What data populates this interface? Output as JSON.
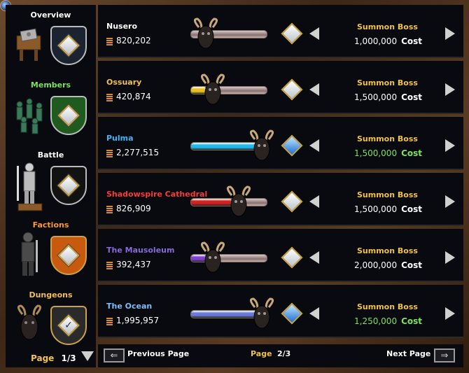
{
  "sidebar": {
    "items": [
      {
        "label": "Overview",
        "color": "#ffffff",
        "shield_color": "#1b2230",
        "shield_border": "#bcbcbc",
        "figure": "table-with-book-icon",
        "gem": "plain"
      },
      {
        "label": "Members",
        "color": "#7be35a",
        "shield_color": "#1f5a1f",
        "shield_border": "#bcbcbc",
        "figure": "party-figures-icon",
        "gem": "plain"
      },
      {
        "label": "Battle",
        "color": "#ffffff",
        "shield_color": "#121212",
        "shield_border": "#bcbcbc",
        "figure": "knight-statue-icon",
        "gem": "plain"
      },
      {
        "label": "Factions",
        "color": "#ff9a2a",
        "shield_color": "#c85a10",
        "shield_border": "#c9a24a",
        "figure": "dark-knight-icon",
        "gem": "plain"
      },
      {
        "label": "Dungeons",
        "color": "#f3c24a",
        "shield_color": "#2a2a2a",
        "shield_border": "#c9a24a",
        "figure": "horned-skull-icon",
        "gem": "check"
      }
    ],
    "page_label": "Page",
    "page_value": "1/3"
  },
  "rows": [
    {
      "name": "Nusero",
      "name_color": "#ffffff",
      "count": "820,202",
      "bar_color": "#8a8080",
      "bar_fill": 0.0,
      "gem": "plain",
      "summon": "Summon Boss",
      "cost": "1,000,000",
      "cost_color": "#ffffff",
      "cost_label": "Cost"
    },
    {
      "name": "Ossuary",
      "name_color": "#f3c24a",
      "count": "420,874",
      "bar_color": "#e8c020",
      "bar_fill": 0.2,
      "gem": "plain",
      "summon": "Summon Boss",
      "cost": "1,500,000",
      "cost_color": "#ffffff",
      "cost_label": "Cost"
    },
    {
      "name": "Pulma",
      "name_color": "#3ab8ff",
      "count": "2,277,515",
      "bar_color": "#20b8e8",
      "bar_fill": 1.0,
      "gem": "blue",
      "summon": "Summon Boss",
      "cost": "1,500,000",
      "cost_color": "#7be35a",
      "cost_label": "Cost"
    },
    {
      "name": "Shadowspire Cathedral",
      "name_color": "#ff3a3a",
      "count": "826,909",
      "bar_color": "#d02020",
      "bar_fill": 0.55,
      "gem": "plain",
      "summon": "Summon Boss",
      "cost": "1,500,000",
      "cost_color": "#ffffff",
      "cost_label": "Cost"
    },
    {
      "name": "The Mausoleum",
      "name_color": "#8a6ae0",
      "count": "392,437",
      "bar_color": "#8040d0",
      "bar_fill": 0.2,
      "gem": "plain",
      "summon": "Summon Boss",
      "cost": "2,000,000",
      "cost_color": "#ffffff",
      "cost_label": "Cost"
    },
    {
      "name": "The Ocean",
      "name_color": "#7ac0ff",
      "count": "1,995,957",
      "bar_color": "#6a7ad8",
      "bar_fill": 1.0,
      "gem": "blue",
      "summon": "Summon Boss",
      "cost": "1,250,000",
      "cost_color": "#7be35a",
      "cost_label": "Cost"
    }
  ],
  "footer": {
    "prev_label": "Previous Page",
    "page_label": "Page",
    "page_value": "2/3",
    "next_label": "Next Page"
  }
}
